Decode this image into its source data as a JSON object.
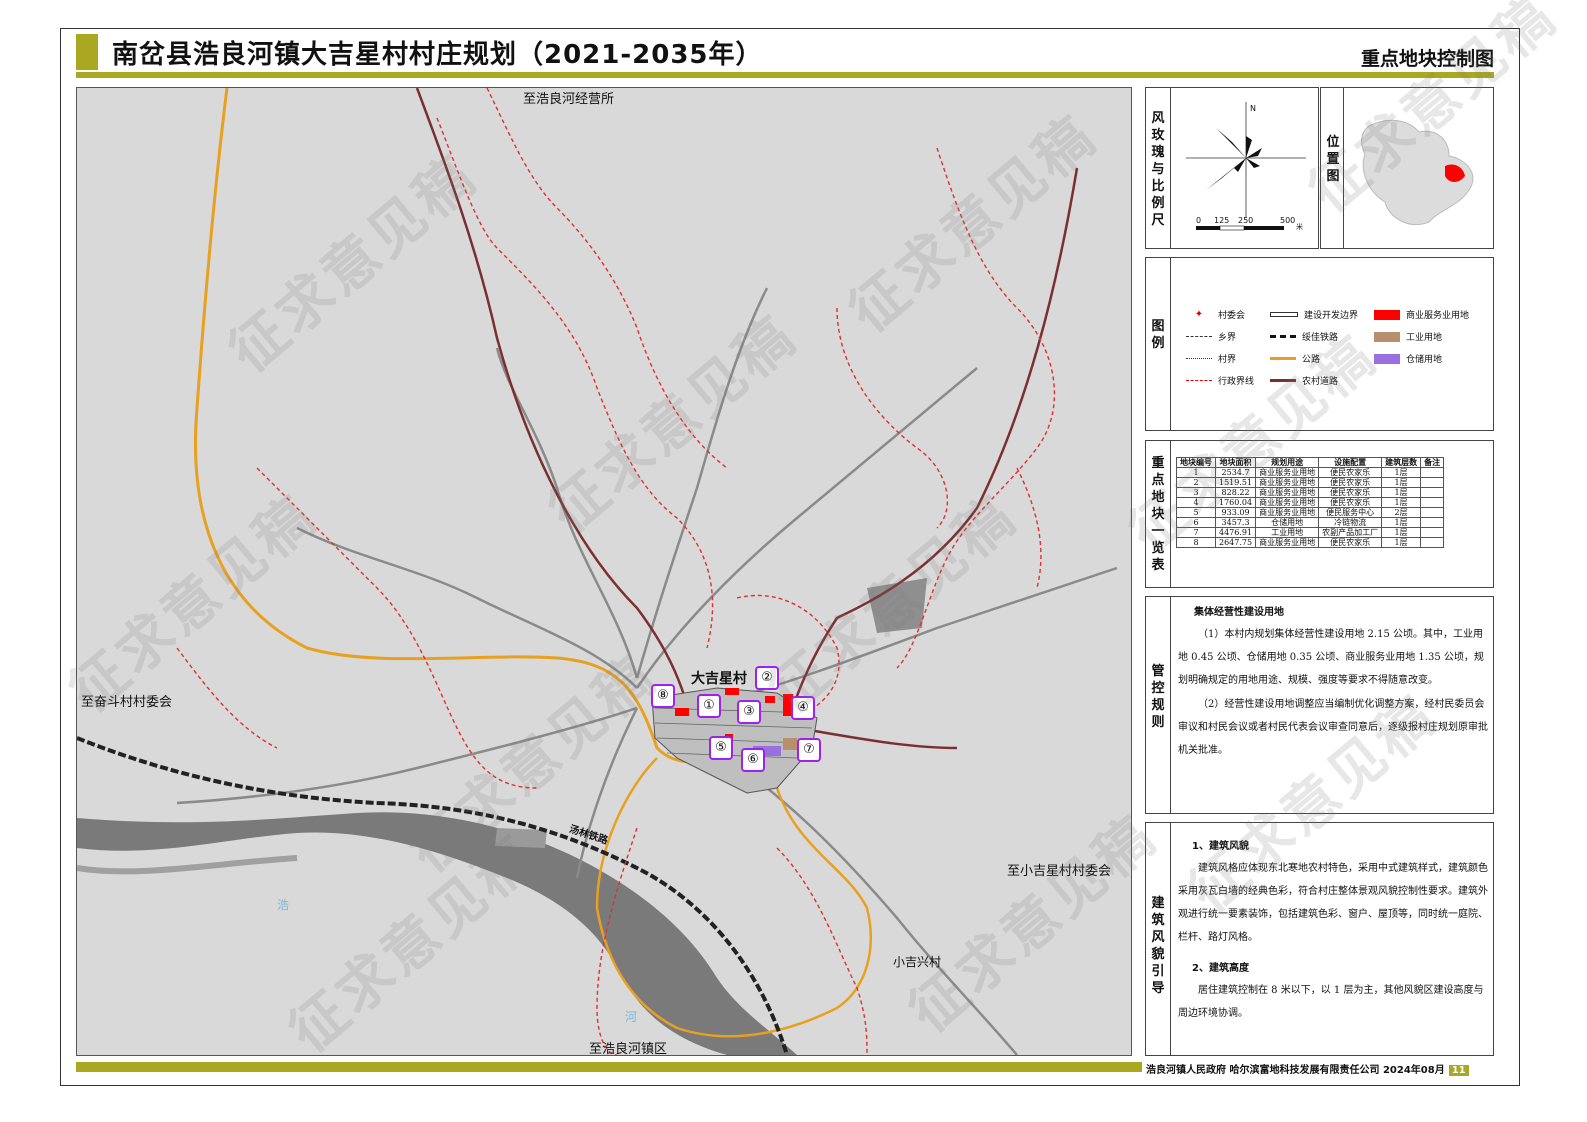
{
  "header": {
    "title": "南岔县浩良河镇大吉星村村庄规划（2021-2035年）",
    "subtitle": "重点地块控制图"
  },
  "map": {
    "labels": {
      "north_dest": "至浩良河经营所",
      "west_dest": "至奋斗村村委会",
      "east_dest": "至小吉星村村委会",
      "south_dest": "至浩良河镇区",
      "village": "大吉星村",
      "village2": "小吉兴村",
      "railway": "汤林铁路",
      "river1": "浩",
      "river2": "河"
    },
    "blocks": [
      "①",
      "②",
      "③",
      "④",
      "⑤",
      "⑥",
      "⑦",
      "⑧"
    ]
  },
  "wind": {
    "label": "风玫瑰与比例尺",
    "north": "N",
    "scale_ticks": [
      "0",
      "125",
      "250",
      "500"
    ],
    "scale_unit": "米"
  },
  "location": {
    "label": "位置图"
  },
  "legend": {
    "label": "图例",
    "items": [
      {
        "name": "村委会",
        "color": "#e00000"
      },
      {
        "name": "乡界",
        "color": "#333333"
      },
      {
        "name": "村界",
        "color": "#333333"
      },
      {
        "name": "行政界线",
        "color": "#e00000"
      },
      {
        "name": "建设开发边界",
        "color": "#333333"
      },
      {
        "name": "绥佳铁路",
        "color": "#111111"
      },
      {
        "name": "公路",
        "color": "#e8a020"
      },
      {
        "name": "农村道路",
        "color": "#7a2e2e"
      },
      {
        "name": "商业服务业用地",
        "color": "#ff0000"
      },
      {
        "name": "工业用地",
        "color": "#b88f6e"
      },
      {
        "name": "仓储用地",
        "color": "#9a6fe0"
      }
    ]
  },
  "table": {
    "label": "重点地块一览表",
    "headers": [
      "地块编号",
      "地块面积",
      "规划用途",
      "设施配置",
      "建筑层数",
      "备注"
    ],
    "rows": [
      [
        "1",
        "2534.7",
        "商业服务业用地",
        "便民农家乐",
        "1层",
        ""
      ],
      [
        "2",
        "1519.51",
        "商业服务业用地",
        "便民农家乐",
        "1层",
        ""
      ],
      [
        "3",
        "828.22",
        "商业服务业用地",
        "便民农家乐",
        "1层",
        ""
      ],
      [
        "4",
        "1760.04",
        "商业服务业用地",
        "便民农家乐",
        "1层",
        ""
      ],
      [
        "5",
        "933.09",
        "商业服务业用地",
        "便民服务中心",
        "2层",
        ""
      ],
      [
        "6",
        "3457.3",
        "仓储用地",
        "冷链物流",
        "1层",
        ""
      ],
      [
        "7",
        "4476.91",
        "工业用地",
        "农副产品加工厂",
        "1层",
        ""
      ],
      [
        "8",
        "2647.75",
        "商业服务业用地",
        "便民农家乐",
        "1层",
        ""
      ]
    ]
  },
  "control": {
    "label": "管控规则",
    "heading": "集体经营性建设用地",
    "p1": "（1）本村内规划集体经营性建设用地 2.15 公顷。其中，工业用地 0.45 公顷、仓储用地 0.35 公顷、商业服务业用地 1.35 公顷，规划明确规定的用地用途、规模、强度等要求不得随意改变。",
    "p2": "（2）经营性建设用地调整应当编制优化调整方案，经村民委员会审议和村民会议或者村民代表会议审查同意后，逐级报村庄规划原审批机关批准。"
  },
  "style_guide": {
    "label": "建筑风貌引导",
    "h1": "1、建筑风貌",
    "p1": "建筑风格应体现东北寒地农村特色，采用中式建筑样式，建筑颜色采用灰瓦白墙的经典色彩，符合村庄整体景观风貌控制性要求。建筑外观进行统一要素装饰，包括建筑色彩、窗户、屋顶等，同时统一庭院、栏杆、路灯风格。",
    "h2": "2、建筑高度",
    "p2": "居住建筑控制在 8 米以下，以 1 层为主，其他风貌区建设高度与周边环境协调。"
  },
  "footer": {
    "text": "浩良河镇人民政府  哈尔滨富地科技发展有限责任公司  2024年08月",
    "page": "11"
  },
  "watermark": "征求意见稿"
}
